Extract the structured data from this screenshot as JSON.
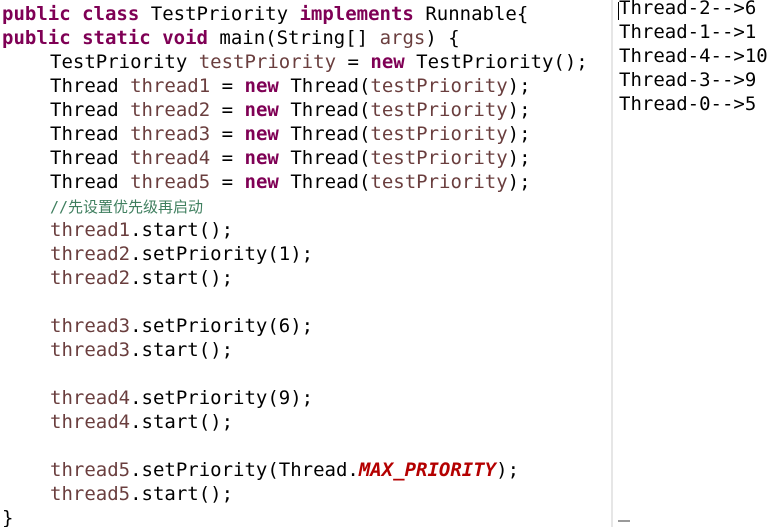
{
  "code": {
    "line1": [
      "public",
      "class",
      "TestPriority",
      "implements",
      "Runnable{"
    ],
    "line2": [
      "public",
      "static",
      "void",
      "main(String[]",
      "args",
      ") {"
    ],
    "line3": [
      "TestPriority",
      "testPriority",
      "=",
      "new",
      "TestPriority();"
    ],
    "thread_decls": [
      {
        "type": "Thread",
        "var": "thread1",
        "eq": "=",
        "kw": "new",
        "ctor": "Thread(",
        "arg": "testPriority",
        "end": ");"
      },
      {
        "type": "Thread",
        "var": "thread2",
        "eq": "=",
        "kw": "new",
        "ctor": "Thread(",
        "arg": "testPriority",
        "end": ");"
      },
      {
        "type": "Thread",
        "var": "thread3",
        "eq": "=",
        "kw": "new",
        "ctor": "Thread(",
        "arg": "testPriority",
        "end": ");"
      },
      {
        "type": "Thread",
        "var": "thread4",
        "eq": "=",
        "kw": "new",
        "ctor": "Thread(",
        "arg": "testPriority",
        "end": ");"
      },
      {
        "type": "Thread",
        "var": "thread5",
        "eq": "=",
        "kw": "new",
        "ctor": "Thread(",
        "arg": "testPriority",
        "end": ");"
      }
    ],
    "comment": "//先设置优先级再启动",
    "stmts": [
      {
        "var": "thread1",
        "rest": ".start();"
      },
      {
        "var": "thread2",
        "rest": ".setPriority(1);"
      },
      {
        "var": "thread2",
        "rest": ".start();"
      },
      {
        "var": "thread3",
        "rest": ".setPriority(6);"
      },
      {
        "var": "thread3",
        "rest": ".start();"
      },
      {
        "var": "thread4",
        "rest": ".setPriority(9);"
      },
      {
        "var": "thread4",
        "rest": ".start();"
      },
      {
        "var": "thread5",
        "rest": ".setPriority(Thread.",
        "const": "MAX_PRIORITY",
        "tail": ");"
      },
      {
        "var": "thread5",
        "rest": ".start();"
      }
    ],
    "closing_brace": "}"
  },
  "console": {
    "lines": [
      "Thread-2-->6",
      "Thread-1-->1",
      "Thread-4-->10",
      "Thread-3-->9",
      "Thread-0-->5"
    ]
  },
  "colors": {
    "keyword": "#7f0055",
    "local_variable": "#6a3e3e",
    "constant": "#b40000",
    "comment": "#3f7f5f"
  }
}
